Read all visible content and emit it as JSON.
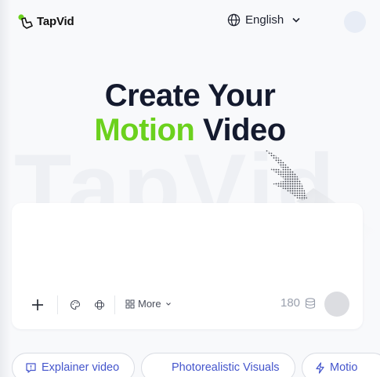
{
  "header": {
    "logo_text": "TapVid",
    "language": "English"
  },
  "hero": {
    "line1": "Create Your",
    "accent_word": "Motion",
    "line2_rest": "Video",
    "watermark": "TapVid"
  },
  "composer": {
    "prompt_value": "",
    "more_label": "More",
    "credits": "180"
  },
  "chips": [
    {
      "label": "Explainer video",
      "icon": "chat-icon"
    },
    {
      "label": "Photorealistic Visuals",
      "icon": ""
    },
    {
      "label": "Motio",
      "icon": "lightning-icon"
    }
  ],
  "colors": {
    "accent": "#6bd11d",
    "heading": "#141a2e",
    "chip_text": "#4455cc"
  }
}
